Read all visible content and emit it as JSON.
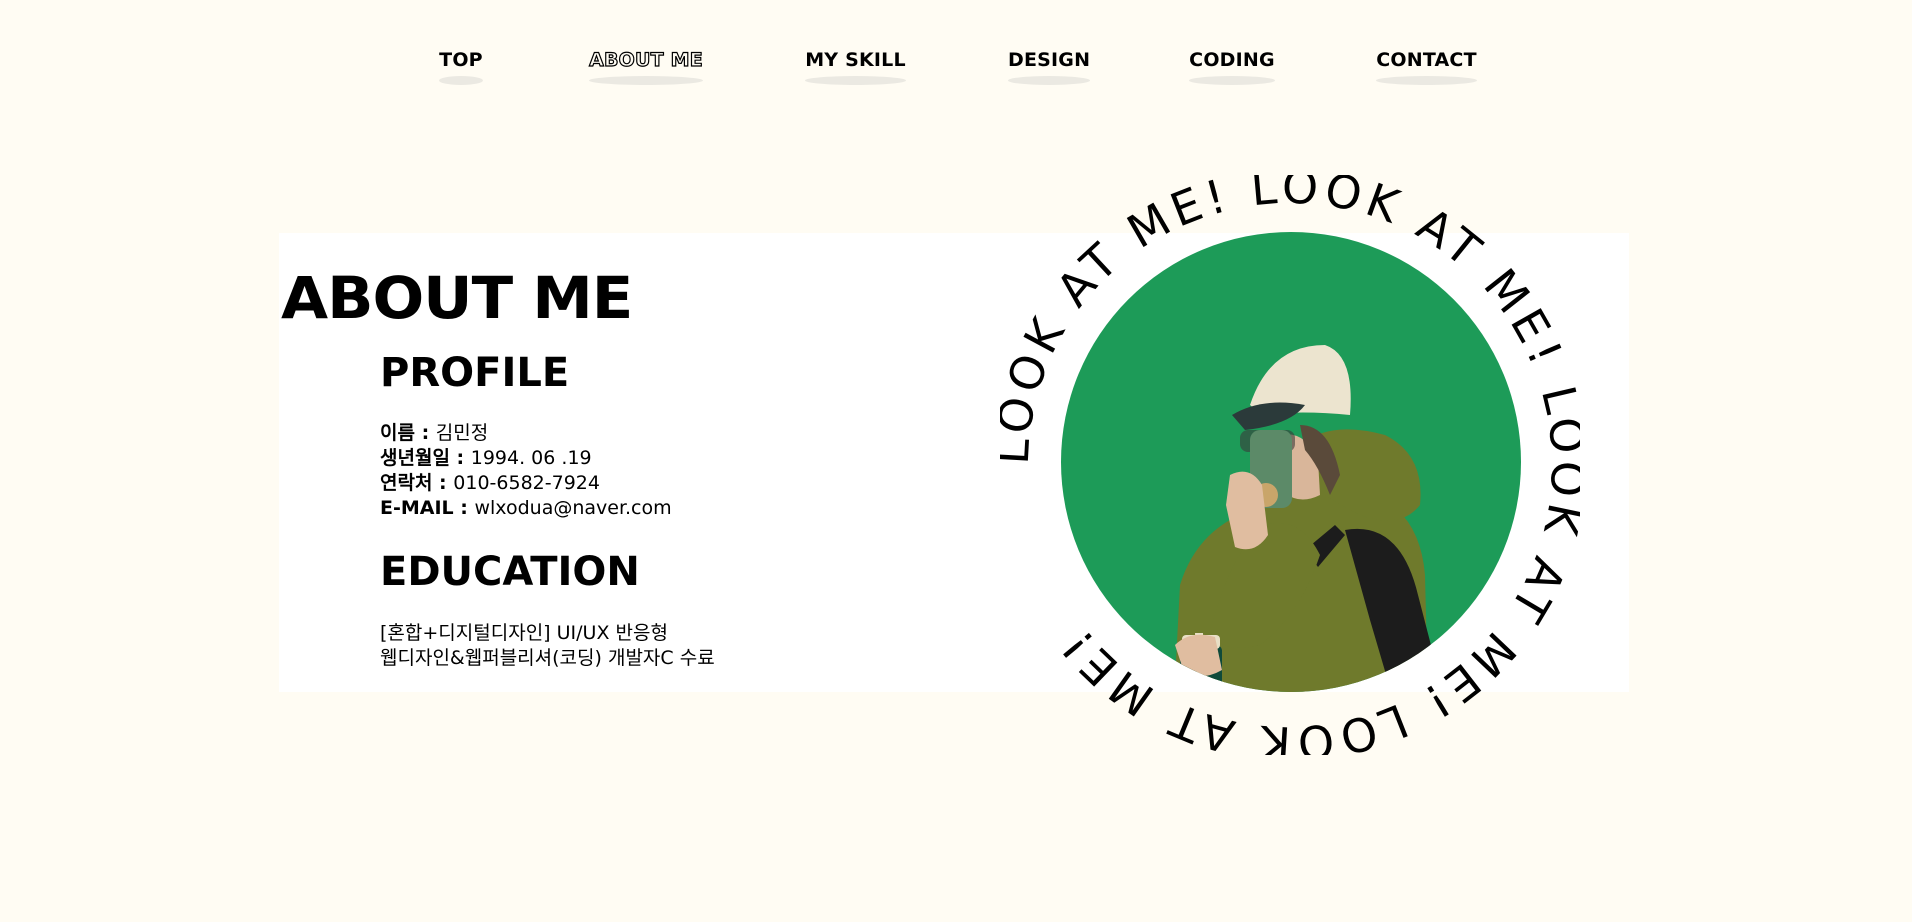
{
  "nav": {
    "items": [
      {
        "label": "TOP",
        "active": false
      },
      {
        "label": "ABOUT ME",
        "active": true
      },
      {
        "label": "MY SKILL",
        "active": false
      },
      {
        "label": "DESIGN",
        "active": false
      },
      {
        "label": "CODING",
        "active": false
      },
      {
        "label": "CONTACT",
        "active": false
      }
    ]
  },
  "about": {
    "title": "ABOUT ME",
    "profile": {
      "heading": "PROFILE",
      "rows": [
        {
          "key": "이름 : ",
          "value": "김민정"
        },
        {
          "key": "생년월일 : ",
          "value": "1994. 06 .19"
        },
        {
          "key": "연락처 : ",
          "value": "010-6582-7924"
        },
        {
          "key": "E-MAIL : ",
          "value": "wlxodua@naver.com"
        }
      ]
    },
    "education": {
      "heading": "EDUCATION",
      "line1": "[혼합+디지털디자인] UI/UX 반응형",
      "line2": "웹디자인&웹퍼블리셔(코딩) 개발자C 수료"
    }
  },
  "photo": {
    "circle_text": "LOOK AT ME! LOOK AT ME! LOOK AT ME! LOOK AT ME! ",
    "circle_color": "#1d9b58",
    "hoodie_color": "#6f7a2c",
    "cap_color": "#ece4cf"
  }
}
